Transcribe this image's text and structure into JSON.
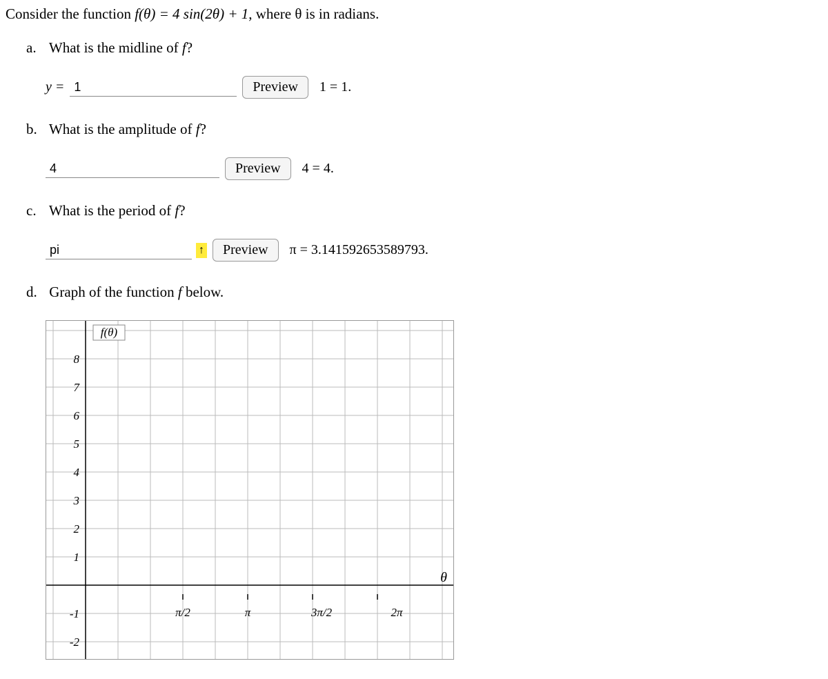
{
  "intro": {
    "text_before": "Consider the function ",
    "func": "f(θ) = 4 sin(2θ) + 1",
    "text_after": ", where θ is in radians."
  },
  "parts": {
    "a": {
      "label": "a.",
      "question": "What is the midline of f?",
      "prefix": "y =",
      "input_value": "1",
      "preview_label": "Preview",
      "result": "1 = 1."
    },
    "b": {
      "label": "b.",
      "question": "What is the amplitude of f?",
      "input_value": "4",
      "preview_label": "Preview",
      "result": "4 = 4."
    },
    "c": {
      "label": "c.",
      "question": "What is the period of f?",
      "input_value": "pi",
      "preview_label": "Preview",
      "result": "π = 3.141592653589793."
    },
    "d": {
      "label": "d.",
      "question": "Graph of the function f below."
    }
  },
  "chart_data": {
    "type": "blank-grid",
    "y_axis_label": "f(θ)",
    "x_axis_label": "θ",
    "y_ticks": [
      8,
      7,
      6,
      5,
      4,
      3,
      2,
      1,
      -1,
      -2
    ],
    "x_ticks": [
      "π/2",
      "π",
      "3π/2",
      "2π"
    ],
    "xlim": [
      -0.7,
      7.0
    ],
    "ylim": [
      -2.5,
      8.5
    ]
  }
}
